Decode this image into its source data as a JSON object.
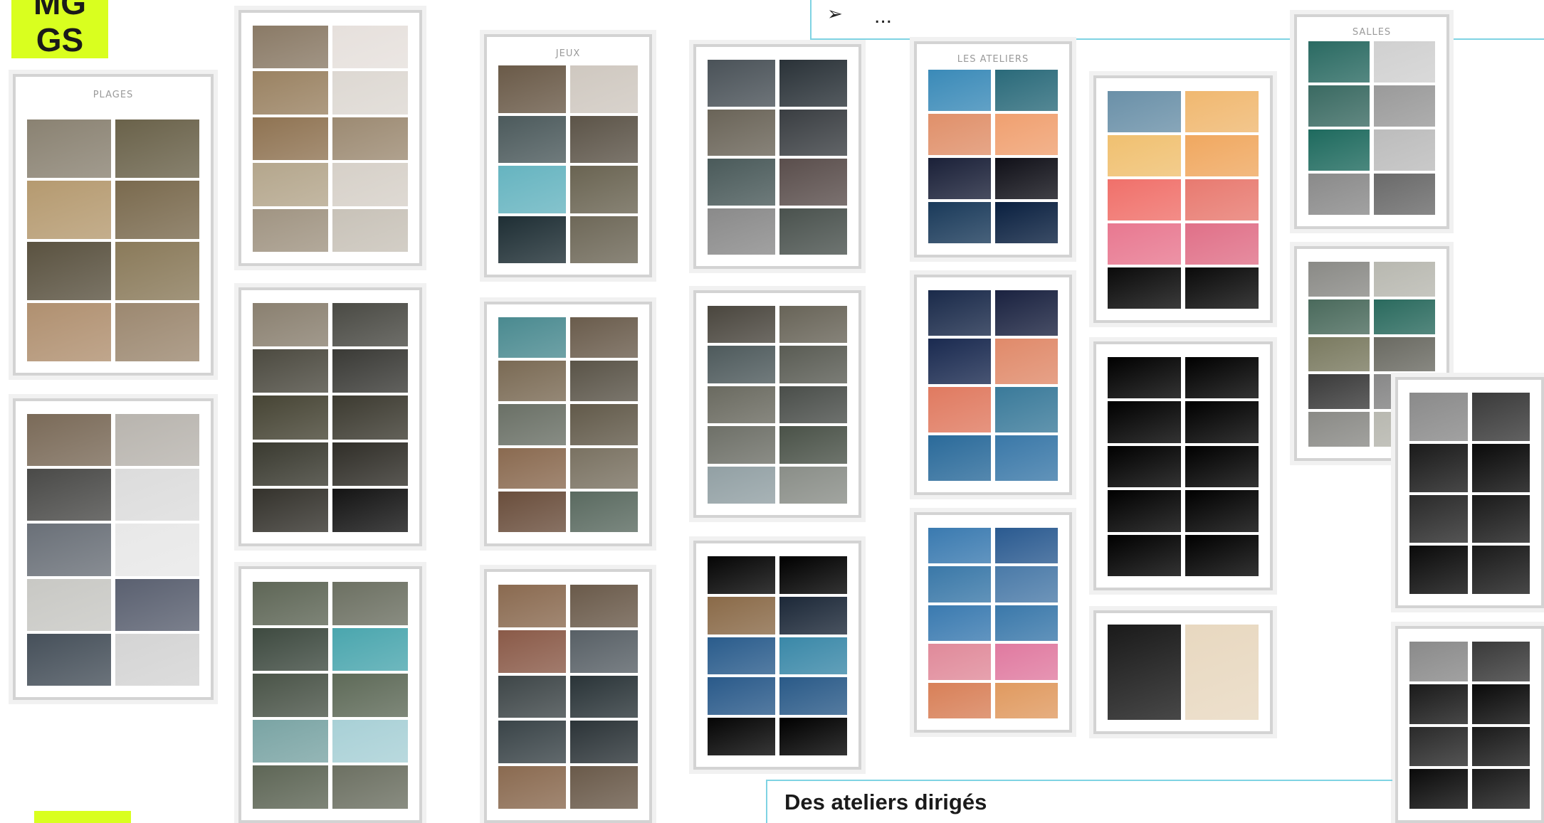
{
  "badge": {
    "line1": "MG",
    "line2": "GS",
    "color": "#d9ff1f"
  },
  "bullets": {
    "arrow": "➢",
    "item": "..."
  },
  "caption": "Des  ateliers dirigés",
  "accent_color": "#7fd3e3",
  "sheets": [
    {
      "id": "s1",
      "title": "PLAGES",
      "frames": [
        "#8a8272",
        "#6a624a",
        "#b59a70",
        "#7a6a4e",
        "#5a5240",
        "#8a7a5a",
        "#b09070",
        "#9c8870"
      ]
    },
    {
      "id": "s2",
      "title": "",
      "frames": [
        "#7a6a58",
        "#b8b4ae",
        "#4a4a48",
        "#dcdcdc",
        "#6a7078",
        "#e8e8e8",
        "#c8c8c4",
        "#5a6070",
        "#46505a",
        "#d4d4d4"
      ]
    },
    {
      "id": "s3",
      "title": "",
      "frames": [
        "#8a7a66",
        "#e6e0dc",
        "#9a8262",
        "#ddd8d2",
        "#8f7352",
        "#9c8a72",
        "#b4a68c",
        "#d6d0c8",
        "#a09482",
        "#c8c2b8"
      ]
    },
    {
      "id": "s4",
      "title": "",
      "frames": [
        "#8a8070",
        "#4a4a44",
        "#4c4a40",
        "#3a3a36",
        "#464434",
        "#3c3a30",
        "#3a3a30",
        "#302e28",
        "#34322c",
        "#141414"
      ]
    },
    {
      "id": "s5",
      "title": "JEUX",
      "frames": [
        "#5e6656",
        "#6c7062",
        "#3e4a40",
        "#4aa6ae",
        "#4a5448",
        "#5e6a58",
        "#7aa4a4",
        "#a8d0d6"
      ]
    },
    {
      "id": "s6",
      "title": "",
      "frames": [
        "#6a5a48",
        "#cfc8c0",
        "#4c5a5c",
        "#5c5448",
        "#66b4c0",
        "#6a6452",
        "#1e2e34",
        "#6e6858",
        "#4c5a58",
        "#808070"
      ]
    },
    {
      "id": "s7",
      "title": "",
      "frames": [
        "#4a8a90",
        "#6a5c4c",
        "#7a6a54",
        "#5a5448",
        "#6a7066",
        "#625a4a",
        "#8a6a50",
        "#7a7262",
        "#6a4e3c",
        "#5a6a60"
      ]
    },
    {
      "id": "s8",
      "title": "",
      "frames": [
        "#8a6a50",
        "#6a5a4a",
        "#8a5a48",
        "#586066",
        "#3e4648",
        "#2a3438",
        "#3a4448",
        "#2c3438"
      ]
    },
    {
      "id": "s9",
      "title": "",
      "frames": [
        "#4a5258",
        "#2a3238",
        "#6a6458",
        "#3a3e42",
        "#4a5a5a",
        "#5a4e4c",
        "#8a8a8a",
        "#4a524e",
        "#6a6e62",
        "#6e7266"
      ]
    },
    {
      "id": "s10",
      "title": "",
      "frames": [
        "#4a463e",
        "#686458",
        "#4e5a5c",
        "#5a5c54",
        "#6a6a60",
        "#4a4e4a",
        "#6e7068",
        "#4a5248",
        "#92a0a4",
        "#8a8e88"
      ]
    },
    {
      "id": "s11",
      "title": "LES ATELIERS",
      "frames": [
        "#050505",
        "#000000",
        "#8a6a48",
        "#1c2838",
        "#2a5c8c",
        "#3a88a8",
        "#2a5a8a",
        "#2a5a88"
      ]
    },
    {
      "id": "s12",
      "title": "",
      "frames": [
        "#3a8ab8",
        "#2a6a7a",
        "#e0906a",
        "#f0a070",
        "#1a2038",
        "#101018",
        "#1a3a5a",
        "#0a2040"
      ]
    },
    {
      "id": "s13",
      "title": "",
      "frames": [
        "#1a2a4a",
        "#1a2240",
        "#1a2a50",
        "#e08a6a",
        "#e07a60",
        "#3a7a9a",
        "#2a6a9a",
        "#3a78a8",
        "#3a6a9a",
        "#4a7aa8"
      ]
    },
    {
      "id": "s14",
      "title": "",
      "frames": [
        "#3a7ab0",
        "#2a5a90",
        "#3a78a8",
        "#4a7aa8",
        "#3a7ab0",
        "#3a78aa",
        "#e08a9a",
        "#e07aa0",
        "#d88058",
        "#e09a60"
      ]
    },
    {
      "id": "s15",
      "title": "",
      "frames": [
        "#6a90a8",
        "#f0b870",
        "#f0c070",
        "#f0a860",
        "#f0706a",
        "#e87a70",
        "#e87890",
        "#e07088",
        "#0a0a0a",
        "#0a0a0a"
      ]
    },
    {
      "id": "s16",
      "title": "",
      "frames": [
        "#000000",
        "#000000"
      ]
    },
    {
      "id": "s17",
      "title": "SALLES",
      "frames": [
        "#1a1a1a",
        "#e8d8c0",
        "#b0b0b0",
        "#8a7a68",
        "#6a6a6a",
        "#2a2a2a",
        "#6a6a6a",
        "#1e6a5e"
      ]
    },
    {
      "id": "s18",
      "title": "",
      "frames": [
        "#2a6a62",
        "#d0d0d0",
        "#3a6a62",
        "#9a9a9a",
        "#1e6a5e",
        "#bcbcbc",
        "#8a8a8a",
        "#6a6a6a",
        "#4a4a4a",
        "#8a8a8a"
      ]
    },
    {
      "id": "s19",
      "title": "",
      "frames": [
        "#8a8a86",
        "#b8b8b0",
        "#4a6a5c",
        "#2a6a5e",
        "#7a7a60",
        "#6a6a62",
        "#3a3a3a",
        "#888888"
      ]
    },
    {
      "id": "s20",
      "title": "",
      "frames": [
        "#8a8a8a",
        "#3a3a3a",
        "#1a1a1a",
        "#0a0a0a",
        "#2a2a2a",
        "#1a1a1a",
        "#0a0a0a",
        "#1a1a1a"
      ]
    }
  ]
}
